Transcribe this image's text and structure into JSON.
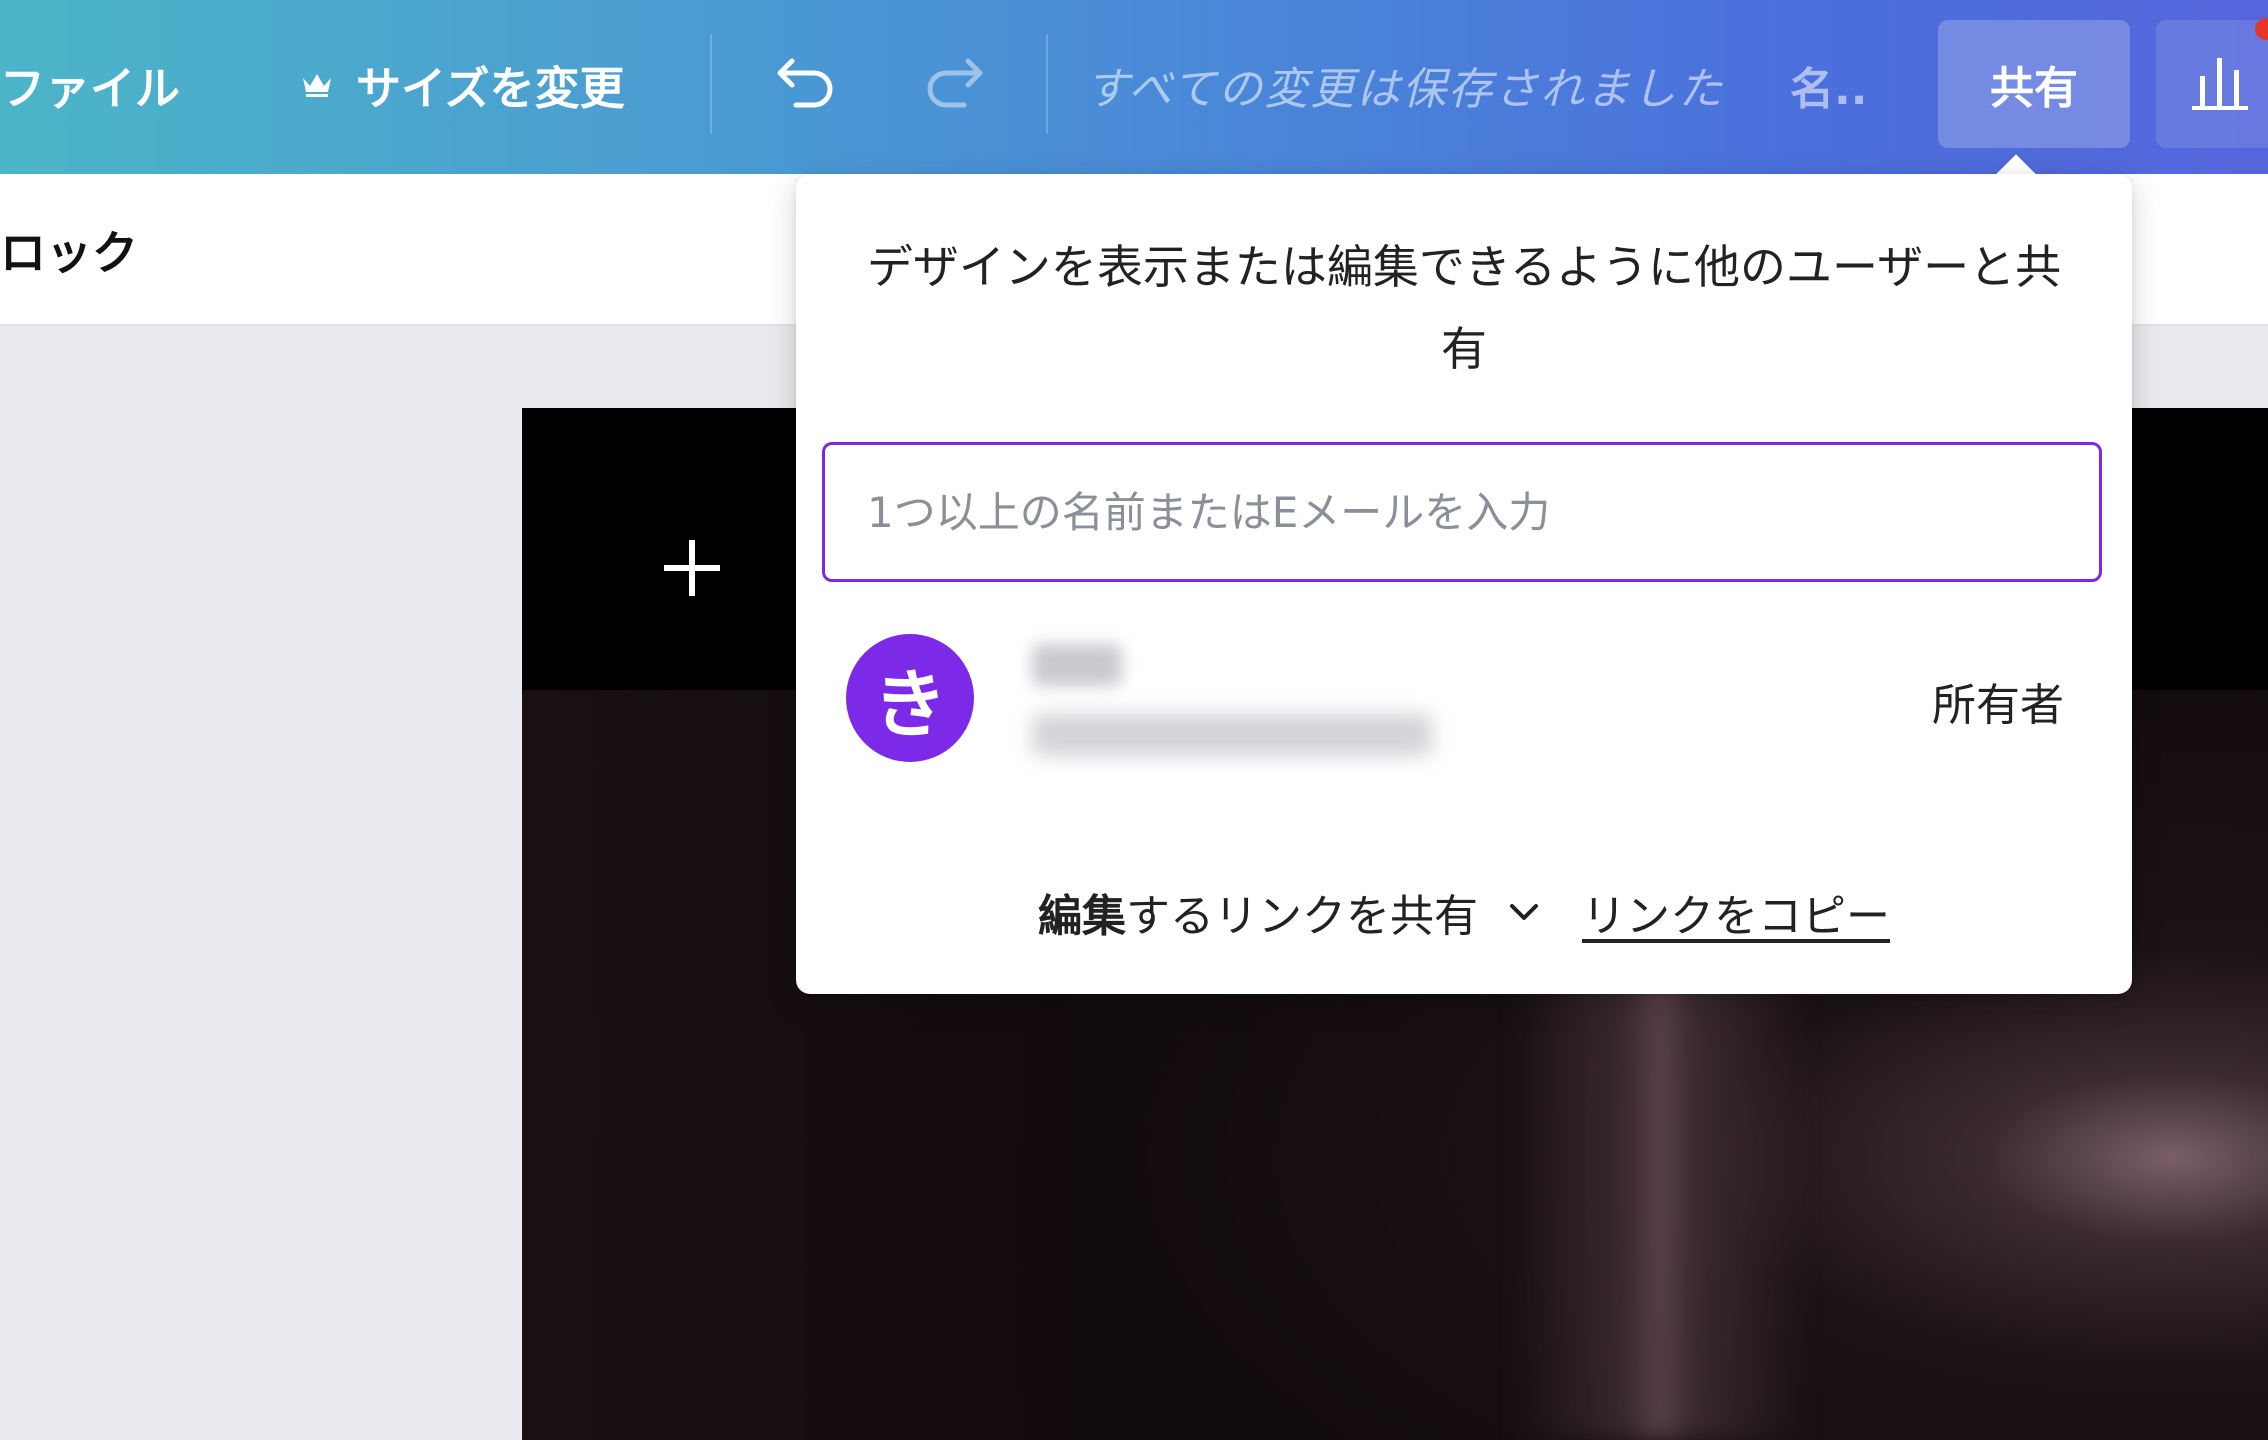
{
  "topbar": {
    "file_label": "ファイル",
    "resize_label": "サイズを変更",
    "save_status": "すべての変更は保存されました",
    "design_name": "名..",
    "share_label": "共有"
  },
  "subbar": {
    "label": "ロック"
  },
  "share_popover": {
    "title": "デザインを表示または編集できるように他のユーザーと共有",
    "input_placeholder": "1つ以上の名前またはEメールを入力",
    "avatar_initial": "き",
    "user_role": "所有者",
    "link_permission_bold": "編集",
    "link_permission_rest": "するリンクを共有",
    "copy_link_label": "リンクをコピー"
  }
}
